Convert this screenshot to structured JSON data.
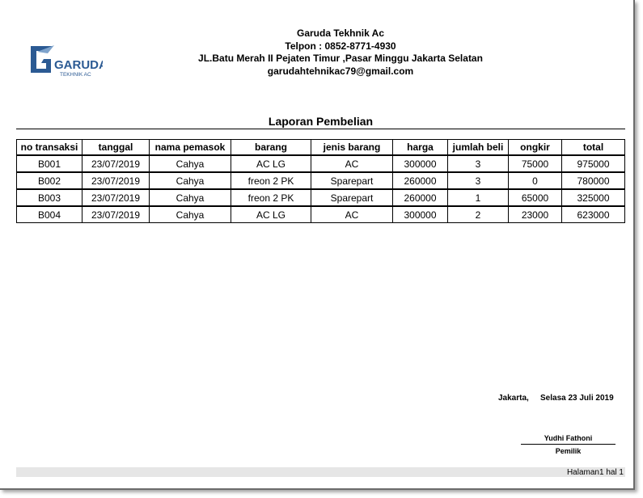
{
  "company": {
    "logo_text": "GARUDA",
    "logo_subtext": "TEKHNIK AC",
    "name": "Garuda Tekhnik Ac",
    "phone": "Telpon : 0852-8771-4930",
    "address": "JL.Batu Merah II Pejaten Timur ,Pasar Minggu Jakarta Selatan",
    "email": "garudahtehnikac79@gmail.com",
    "brand_color": "#2b5a93"
  },
  "report": {
    "title": "Laporan Pembelian",
    "columns": [
      "no transaksi",
      "tanggal",
      "nama pemasok",
      "barang",
      "jenis barang",
      "harga",
      "jumlah beli",
      "ongkir",
      "total"
    ],
    "rows": [
      [
        "B001",
        "23/07/2019",
        "Cahya",
        "AC LG",
        "AC",
        "300000",
        "3",
        "75000",
        "975000"
      ],
      [
        "B002",
        "23/07/2019",
        "Cahya",
        "freon 2 PK",
        "Sparepart",
        "260000",
        "3",
        "0",
        "780000"
      ],
      [
        "B003",
        "23/07/2019",
        "Cahya",
        "freon 2 PK",
        "Sparepart",
        "260000",
        "1",
        "65000",
        "325000"
      ],
      [
        "B004",
        "23/07/2019",
        "Cahya",
        "AC LG",
        "AC",
        "300000",
        "2",
        "23000",
        "623000"
      ]
    ]
  },
  "signature": {
    "place": "Jakarta,",
    "date": "Selasa 23 Juli 2019",
    "name": "Yudhi Fathoni",
    "role": "Pemilik"
  },
  "footer": {
    "page_label": "Halaman1 hal 1"
  }
}
